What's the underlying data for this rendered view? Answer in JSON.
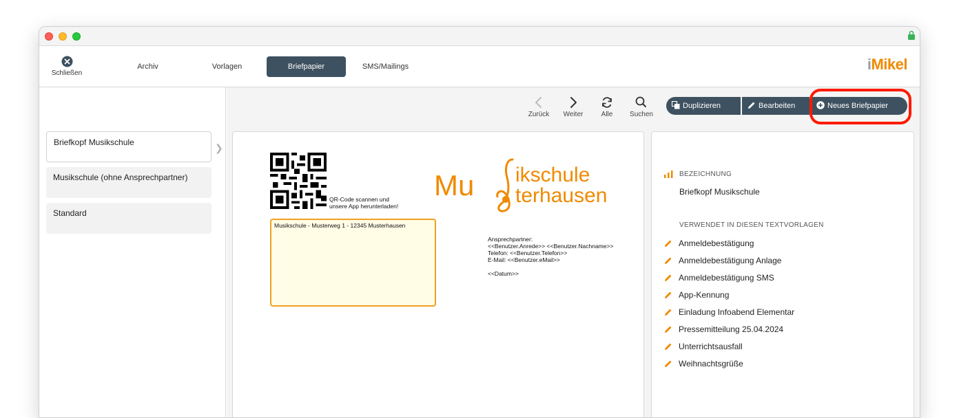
{
  "toolbar": {
    "close_label": "Schließen",
    "tabs": [
      {
        "label": "Archiv"
      },
      {
        "label": "Vorlagen"
      },
      {
        "label": "Briefpapier"
      },
      {
        "label": "SMS/Mailings"
      }
    ],
    "active_tab": "Briefpapier",
    "logo_text_i": "i",
    "logo_text_rest": "Mikel"
  },
  "sidebar": {
    "items": [
      {
        "label": "Briefkopf Musikschule",
        "selected": true
      },
      {
        "label": "Musikschule (ohne Ansprechpartner)"
      },
      {
        "label": "Standard"
      }
    ]
  },
  "nav": {
    "back": "Zurück",
    "forward": "Weiter",
    "all": "Alle",
    "search": "Suchen"
  },
  "actions": {
    "duplicate": "Duplizieren",
    "edit": "Bearbeiten",
    "new": "Neues Briefpapier"
  },
  "preview": {
    "qr_text_1": "QR-Code scannen und",
    "qr_text_2": "unsere App herunterladen!",
    "logo_line1_a": "Mu",
    "logo_line1_b": "ikschule",
    "logo_line2": "terhausen",
    "address": "Musikschule - Musterweg 1 - 12345 Musterhausen",
    "contact_lines": [
      "Ansprechpartner:",
      "<<Benutzer.Anrede>> <<Benutzer.Nachname>>",
      "Telefon: <<Benutzer.Telefon>>",
      "E-Mail: <<Benutzer.eMail>>",
      "",
      "<<Datum>>"
    ]
  },
  "detail": {
    "name_header": "BEZEICHNUNG",
    "name_value": "Briefkopf Musikschule",
    "used_header": "VERWENDET IN DIESEN TEXTVORLAGEN",
    "used_in": [
      "Anmeldebestätigung",
      "Anmeldebestätigung Anlage",
      "Anmeldebestätigung SMS",
      "App-Kennung",
      "Einladung Infoabend Elementar",
      "Pressemitteilung 25.04.2024",
      "Unterrichtsausfall",
      "Weihnachtsgrüße"
    ]
  },
  "colors": {
    "accent": "#f08a00",
    "button_bg": "#3e5160",
    "highlight": "#ff1a00"
  }
}
